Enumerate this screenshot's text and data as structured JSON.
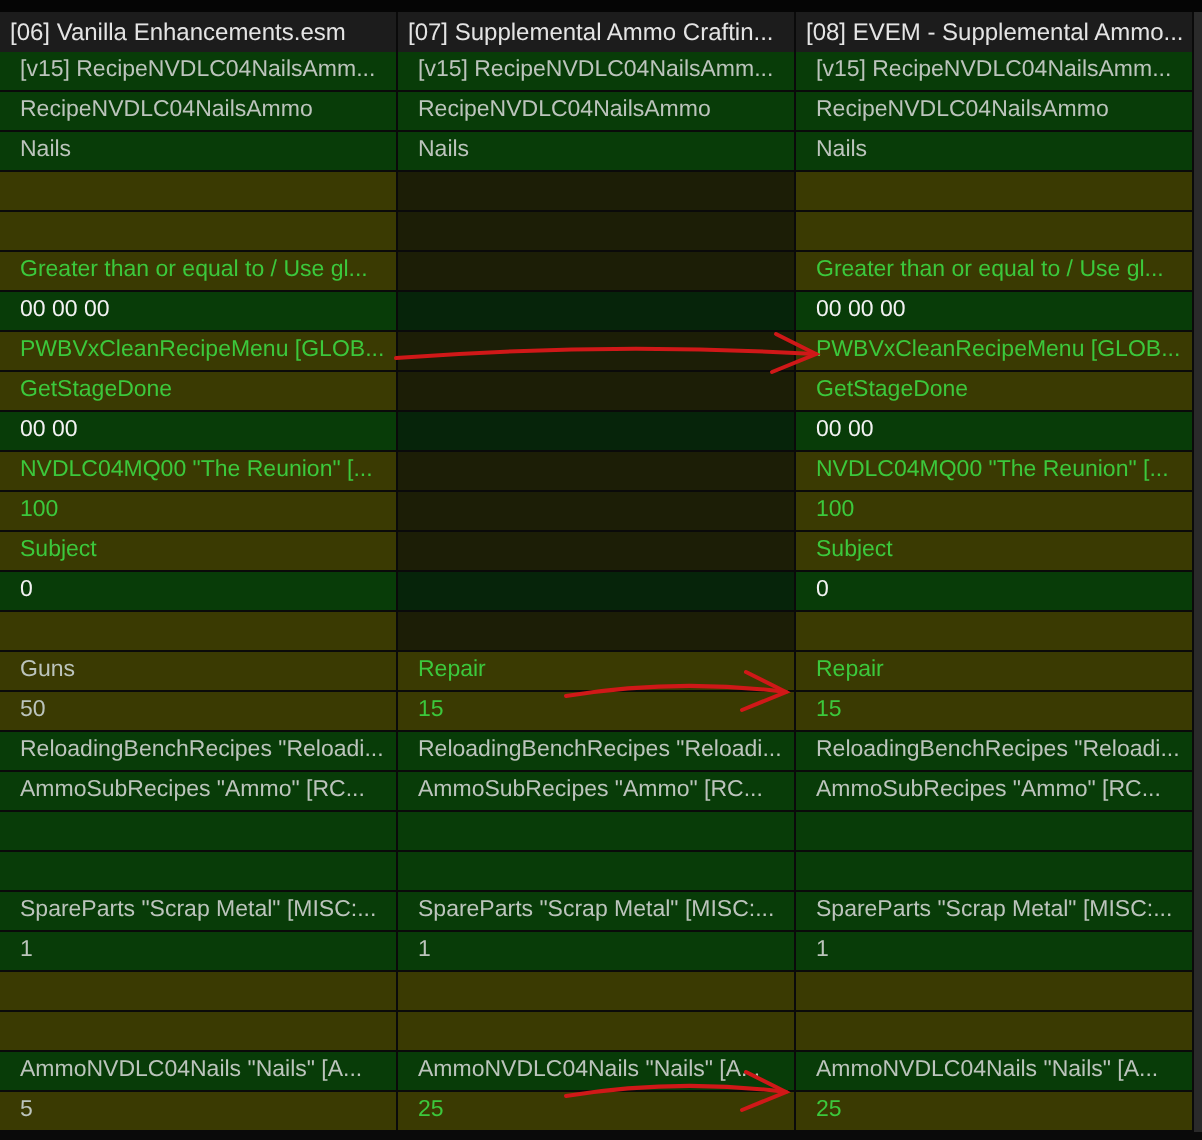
{
  "columns": [
    "[06] Vanilla Enhancements.esm",
    "[07] Supplemental Ammo Craftin...",
    "[08] EVEM - Supplemental Ammo..."
  ],
  "rows": [
    {
      "cells": [
        {
          "kind": "text",
          "text": "[v15] RecipeNVDLC04NailsAmm...",
          "conflict": false,
          "highlighted": false,
          "inactive": false
        },
        {
          "kind": "text",
          "text": "[v15] RecipeNVDLC04NailsAmm...",
          "conflict": false,
          "highlighted": false,
          "inactive": false
        },
        {
          "kind": "text",
          "text": "[v15] RecipeNVDLC04NailsAmm...",
          "conflict": false,
          "highlighted": false,
          "inactive": false
        }
      ]
    },
    {
      "cells": [
        {
          "kind": "text",
          "text": "RecipeNVDLC04NailsAmmo",
          "conflict": false,
          "highlighted": false,
          "inactive": false
        },
        {
          "kind": "text",
          "text": "RecipeNVDLC04NailsAmmo",
          "conflict": false,
          "highlighted": false,
          "inactive": false
        },
        {
          "kind": "text",
          "text": "RecipeNVDLC04NailsAmmo",
          "conflict": false,
          "highlighted": false,
          "inactive": false
        }
      ]
    },
    {
      "cells": [
        {
          "kind": "text",
          "text": "Nails",
          "conflict": false,
          "highlighted": false,
          "inactive": false
        },
        {
          "kind": "text",
          "text": "Nails",
          "conflict": false,
          "highlighted": false,
          "inactive": false
        },
        {
          "kind": "text",
          "text": "Nails",
          "conflict": false,
          "highlighted": false,
          "inactive": false
        }
      ]
    },
    {
      "cells": [
        {
          "kind": "empty",
          "conflict": true,
          "inactive": false
        },
        {
          "kind": "empty",
          "conflict": true,
          "inactive": true
        },
        {
          "kind": "empty",
          "conflict": true,
          "inactive": false
        }
      ]
    },
    {
      "cells": [
        {
          "kind": "empty",
          "conflict": true,
          "inactive": false
        },
        {
          "kind": "empty",
          "conflict": true,
          "inactive": true
        },
        {
          "kind": "empty",
          "conflict": true,
          "inactive": false
        }
      ]
    },
    {
      "cells": [
        {
          "kind": "text",
          "text": "Greater than or equal to / Use gl...",
          "conflict": true,
          "highlighted": true,
          "inactive": false
        },
        {
          "kind": "empty",
          "conflict": true,
          "inactive": true
        },
        {
          "kind": "text",
          "text": "Greater than or equal to / Use gl...",
          "conflict": true,
          "highlighted": true,
          "inactive": false
        }
      ]
    },
    {
      "cells": [
        {
          "kind": "bytes",
          "text": "00 00 00",
          "conflict": false,
          "highlighted": false,
          "inactive": false
        },
        {
          "kind": "empty",
          "conflict": false,
          "inactive": true
        },
        {
          "kind": "bytes",
          "text": "00 00 00",
          "conflict": false,
          "highlighted": false,
          "inactive": false
        }
      ]
    },
    {
      "arrow": true,
      "long_arrow": true,
      "cells": [
        {
          "kind": "text",
          "text": "PWBVxCleanRecipeMenu [GLOB...",
          "conflict": true,
          "highlighted": true,
          "inactive": false
        },
        {
          "kind": "empty",
          "conflict": true,
          "inactive": true
        },
        {
          "kind": "text",
          "text": "PWBVxCleanRecipeMenu [GLOB...",
          "conflict": true,
          "highlighted": true,
          "inactive": false
        }
      ]
    },
    {
      "cells": [
        {
          "kind": "text",
          "text": "GetStageDone",
          "conflict": true,
          "highlighted": true,
          "inactive": false
        },
        {
          "kind": "empty",
          "conflict": true,
          "inactive": true
        },
        {
          "kind": "text",
          "text": "GetStageDone",
          "conflict": true,
          "highlighted": true,
          "inactive": false
        }
      ]
    },
    {
      "cells": [
        {
          "kind": "bytes",
          "text": "00 00",
          "conflict": false,
          "highlighted": false,
          "inactive": false
        },
        {
          "kind": "empty",
          "conflict": false,
          "inactive": true
        },
        {
          "kind": "bytes",
          "text": "00 00",
          "conflict": false,
          "highlighted": false,
          "inactive": false
        }
      ]
    },
    {
      "cells": [
        {
          "kind": "text",
          "text": "NVDLC04MQ00 \"The Reunion\" [...",
          "conflict": true,
          "highlighted": true,
          "inactive": false
        },
        {
          "kind": "empty",
          "conflict": true,
          "inactive": true
        },
        {
          "kind": "text",
          "text": "NVDLC04MQ00 \"The Reunion\" [...",
          "conflict": true,
          "highlighted": true,
          "inactive": false
        }
      ]
    },
    {
      "cells": [
        {
          "kind": "text",
          "text": "100",
          "conflict": true,
          "highlighted": true,
          "inactive": false
        },
        {
          "kind": "empty",
          "conflict": true,
          "inactive": true
        },
        {
          "kind": "text",
          "text": "100",
          "conflict": true,
          "highlighted": true,
          "inactive": false
        }
      ]
    },
    {
      "cells": [
        {
          "kind": "text",
          "text": "Subject",
          "conflict": true,
          "highlighted": true,
          "inactive": false
        },
        {
          "kind": "empty",
          "conflict": true,
          "inactive": true
        },
        {
          "kind": "text",
          "text": "Subject",
          "conflict": true,
          "highlighted": true,
          "inactive": false
        }
      ]
    },
    {
      "cells": [
        {
          "kind": "bytes",
          "text": "0",
          "conflict": false,
          "highlighted": false,
          "inactive": false
        },
        {
          "kind": "empty",
          "conflict": false,
          "inactive": true
        },
        {
          "kind": "bytes",
          "text": "0",
          "conflict": false,
          "highlighted": false,
          "inactive": false
        }
      ]
    },
    {
      "cells": [
        {
          "kind": "empty",
          "conflict": true,
          "inactive": false
        },
        {
          "kind": "empty",
          "conflict": true,
          "inactive": true
        },
        {
          "kind": "empty",
          "conflict": true,
          "inactive": false
        }
      ]
    },
    {
      "arrow": true,
      "long_arrow": false,
      "cells": [
        {
          "kind": "text",
          "text": "Guns",
          "conflict": true,
          "highlighted": false,
          "inactive": false
        },
        {
          "kind": "text",
          "text": "Repair",
          "conflict": true,
          "highlighted": true,
          "inactive": false
        },
        {
          "kind": "text",
          "text": "Repair",
          "conflict": true,
          "highlighted": true,
          "inactive": false
        }
      ]
    },
    {
      "cells": [
        {
          "kind": "text",
          "text": "50",
          "conflict": true,
          "highlighted": false,
          "inactive": false
        },
        {
          "kind": "text",
          "text": "15",
          "conflict": true,
          "highlighted": true,
          "inactive": false
        },
        {
          "kind": "text",
          "text": "15",
          "conflict": true,
          "highlighted": true,
          "inactive": false
        }
      ]
    },
    {
      "cells": [
        {
          "kind": "text",
          "text": "ReloadingBenchRecipes \"Reloadi...",
          "conflict": false,
          "highlighted": false,
          "inactive": false
        },
        {
          "kind": "text",
          "text": "ReloadingBenchRecipes \"Reloadi...",
          "conflict": false,
          "highlighted": false,
          "inactive": false
        },
        {
          "kind": "text",
          "text": "ReloadingBenchRecipes \"Reloadi...",
          "conflict": false,
          "highlighted": false,
          "inactive": false
        }
      ]
    },
    {
      "cells": [
        {
          "kind": "text",
          "text": "AmmoSubRecipes \"Ammo\" [RC...",
          "conflict": false,
          "highlighted": false,
          "inactive": false
        },
        {
          "kind": "text",
          "text": "AmmoSubRecipes \"Ammo\" [RC...",
          "conflict": false,
          "highlighted": false,
          "inactive": false
        },
        {
          "kind": "text",
          "text": "AmmoSubRecipes \"Ammo\" [RC...",
          "conflict": false,
          "highlighted": false,
          "inactive": false
        }
      ]
    },
    {
      "cells": [
        {
          "kind": "empty",
          "conflict": false,
          "inactive": false
        },
        {
          "kind": "empty",
          "conflict": false,
          "inactive": false
        },
        {
          "kind": "empty",
          "conflict": false,
          "inactive": false
        }
      ]
    },
    {
      "cells": [
        {
          "kind": "empty",
          "conflict": false,
          "inactive": false
        },
        {
          "kind": "empty",
          "conflict": false,
          "inactive": false
        },
        {
          "kind": "empty",
          "conflict": false,
          "inactive": false
        }
      ]
    },
    {
      "cells": [
        {
          "kind": "text",
          "text": "SpareParts \"Scrap Metal\" [MISC:...",
          "conflict": false,
          "highlighted": false,
          "inactive": false
        },
        {
          "kind": "text",
          "text": "SpareParts \"Scrap Metal\" [MISC:...",
          "conflict": false,
          "highlighted": false,
          "inactive": false
        },
        {
          "kind": "text",
          "text": "SpareParts \"Scrap Metal\" [MISC:...",
          "conflict": false,
          "highlighted": false,
          "inactive": false
        }
      ]
    },
    {
      "cells": [
        {
          "kind": "text",
          "text": "1",
          "conflict": false,
          "highlighted": false,
          "inactive": false
        },
        {
          "kind": "text",
          "text": "1",
          "conflict": false,
          "highlighted": false,
          "inactive": false
        },
        {
          "kind": "text",
          "text": "1",
          "conflict": false,
          "highlighted": false,
          "inactive": false
        }
      ]
    },
    {
      "cells": [
        {
          "kind": "empty",
          "conflict": true,
          "inactive": false
        },
        {
          "kind": "empty",
          "conflict": true,
          "inactive": false
        },
        {
          "kind": "empty",
          "conflict": true,
          "inactive": false
        }
      ]
    },
    {
      "cells": [
        {
          "kind": "empty",
          "conflict": true,
          "inactive": false
        },
        {
          "kind": "empty",
          "conflict": true,
          "inactive": false
        },
        {
          "kind": "empty",
          "conflict": true,
          "inactive": false
        }
      ]
    },
    {
      "arrow": true,
      "long_arrow": false,
      "cells": [
        {
          "kind": "text",
          "text": "AmmoNVDLC04Nails \"Nails\" [A...",
          "conflict": false,
          "highlighted": false,
          "inactive": false
        },
        {
          "kind": "text",
          "text": "AmmoNVDLC04Nails \"Nails\" [A...",
          "conflict": false,
          "highlighted": false,
          "inactive": false
        },
        {
          "kind": "text",
          "text": "AmmoNVDLC04Nails \"Nails\" [A...",
          "conflict": false,
          "highlighted": false,
          "inactive": false
        }
      ]
    },
    {
      "cells": [
        {
          "kind": "text",
          "text": "5",
          "conflict": true,
          "highlighted": false,
          "inactive": false
        },
        {
          "kind": "text",
          "text": "25",
          "conflict": true,
          "highlighted": true,
          "inactive": false
        },
        {
          "kind": "text",
          "text": "25",
          "conflict": true,
          "highlighted": true,
          "inactive": false
        }
      ]
    }
  ]
}
